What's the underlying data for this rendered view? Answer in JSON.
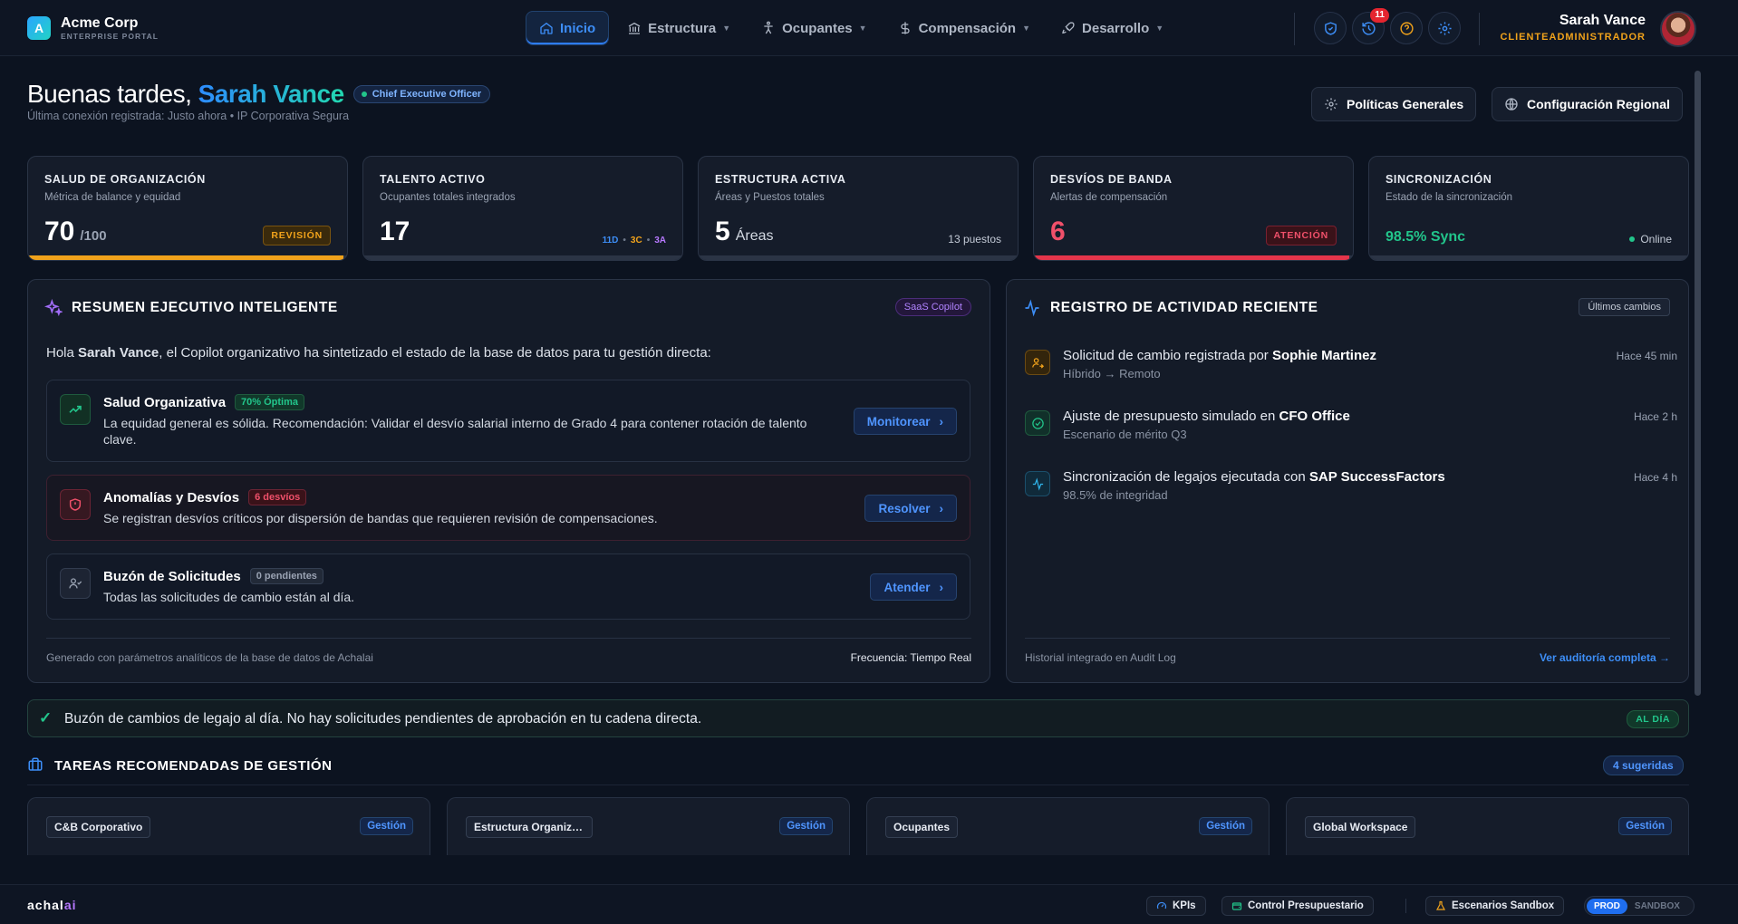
{
  "header": {
    "logo_letter": "A",
    "brand": "Acme Corp",
    "brand_sub": "ENTERPRISE PORTAL",
    "nav": [
      {
        "label": "Inicio",
        "icon": "home-icon",
        "active": true
      },
      {
        "label": "Estructura",
        "icon": "bank-icon"
      },
      {
        "label": "Ocupantes",
        "icon": "person-icon"
      },
      {
        "label": "Compensación",
        "icon": "dollar-icon"
      },
      {
        "label": "Desarrollo",
        "icon": "rocket-icon"
      }
    ],
    "notifications_count": "11",
    "user_name": "Sarah Vance",
    "user_role": "CLIENTEADMINISTRADOR"
  },
  "greeting": {
    "prefix": "Buenas tardes,",
    "name": "Sarah Vance",
    "role": "Chief Executive Officer",
    "last_login": "Última conexión registrada: Justo ahora • IP Corporativa Segura",
    "btn_policies": "Políticas Generales",
    "btn_regional": "Configuración Regional"
  },
  "stats": [
    {
      "title": "SALUD DE ORGANIZACIÓN",
      "sub": "Métrica de balance y equidad",
      "value": "70",
      "suffix": "/100",
      "tag": "REVISIÓN",
      "progress": 0.99
    },
    {
      "title": "TALENTO ACTIVO",
      "sub": "Ocupantes totales integrados",
      "value": "17",
      "breakdown": [
        "11D",
        "3C",
        "3A"
      ]
    },
    {
      "title": "ESTRUCTURA ACTIVA",
      "sub": "Áreas y Puestos totales",
      "value": "5",
      "unit": "Áreas",
      "extra": "13 puestos"
    },
    {
      "title": "DESVÍOS DE BANDA",
      "sub": "Alertas de compensación",
      "value": "6",
      "tag": "ATENCIÓN",
      "progress": 0.99
    },
    {
      "title": "SINCRONIZACIÓN",
      "sub": "Estado de la sincronización",
      "value": "98.5% Sync",
      "status": "Online"
    }
  ],
  "summary": {
    "title": "RESUMEN EJECUTIVO INTELIGENTE",
    "badge": "SaaS Copilot",
    "intro_pre": "Hola",
    "intro_name": "Sarah Vance",
    "intro_post": ", el Copilot organizativo ha sintetizado el estado de la base de datos para tu gestión directa:",
    "cards": [
      {
        "title": "Salud Organizativa",
        "badge": "70% Óptima",
        "desc": "La equidad general es sólida. Recomendación: Validar el desvío salarial interno de Grado 4 para contener rotación de talento clave.",
        "action": "Monitorear"
      },
      {
        "title": "Anomalías y Desvíos",
        "badge": "6 desvíos",
        "desc": "Se registran desvíos críticos por dispersión de bandas que requieren revisión de compensaciones.",
        "action": "Resolver"
      },
      {
        "title": "Buzón de Solicitudes",
        "badge": "0 pendientes",
        "desc": "Todas las solicitudes de cambio están al día.",
        "action": "Atender"
      }
    ],
    "footer_left": "Generado con parámetros analíticos de la base de datos de Achalai",
    "footer_right": "Frecuencia: Tiempo Real"
  },
  "activity": {
    "title": "REGISTRO DE ACTIVIDAD RECIENTE",
    "badge": "Últimos cambios",
    "items": [
      {
        "text": "Solicitud de cambio registrada por",
        "bold": "Sophie Martinez",
        "sub": "Híbrido → Remoto",
        "time": "Hace 45 min"
      },
      {
        "text": "Ajuste de presupuesto simulado en",
        "bold": "CFO Office",
        "sub": "Escenario de mérito Q3",
        "time": "Hace 2 h"
      },
      {
        "text": "Sincronización de legajos ejecutada con",
        "bold": "SAP SuccessFactors",
        "sub": "98.5% de integridad",
        "time": "Hace 4 h"
      }
    ],
    "footer_left": "Historial integrado en Audit Log",
    "footer_link": "Ver auditoría completa →"
  },
  "banner": {
    "text": "Buzón de cambios de legajo al día. No hay solicitudes pendientes de aprobación en tu cadena directa.",
    "badge": "AL DÍA"
  },
  "tasks": {
    "title": "TAREAS RECOMENDADAS DE GESTIÓN",
    "count": "4 sugeridas",
    "cards": [
      {
        "label": "C&B Corporativo",
        "badge": "Gestión"
      },
      {
        "label": "Estructura Organizativa",
        "badge": "Gestión"
      },
      {
        "label": "Ocupantes",
        "badge": "Gestión"
      },
      {
        "label": "Global Workspace",
        "badge": "Gestión"
      }
    ]
  },
  "footer": {
    "logo_a": "achal",
    "logo_b": "ai",
    "kpis": "KPIs",
    "budget": "Control Presupuestario",
    "sandbox": "Escenarios Sandbox",
    "env_on": "PROD",
    "env_off": "SANDBOX"
  },
  "colors": {
    "accent": "#2e7cf0",
    "warning": "#f0a21b",
    "danger": "#e5354b",
    "success": "#22c58b"
  }
}
